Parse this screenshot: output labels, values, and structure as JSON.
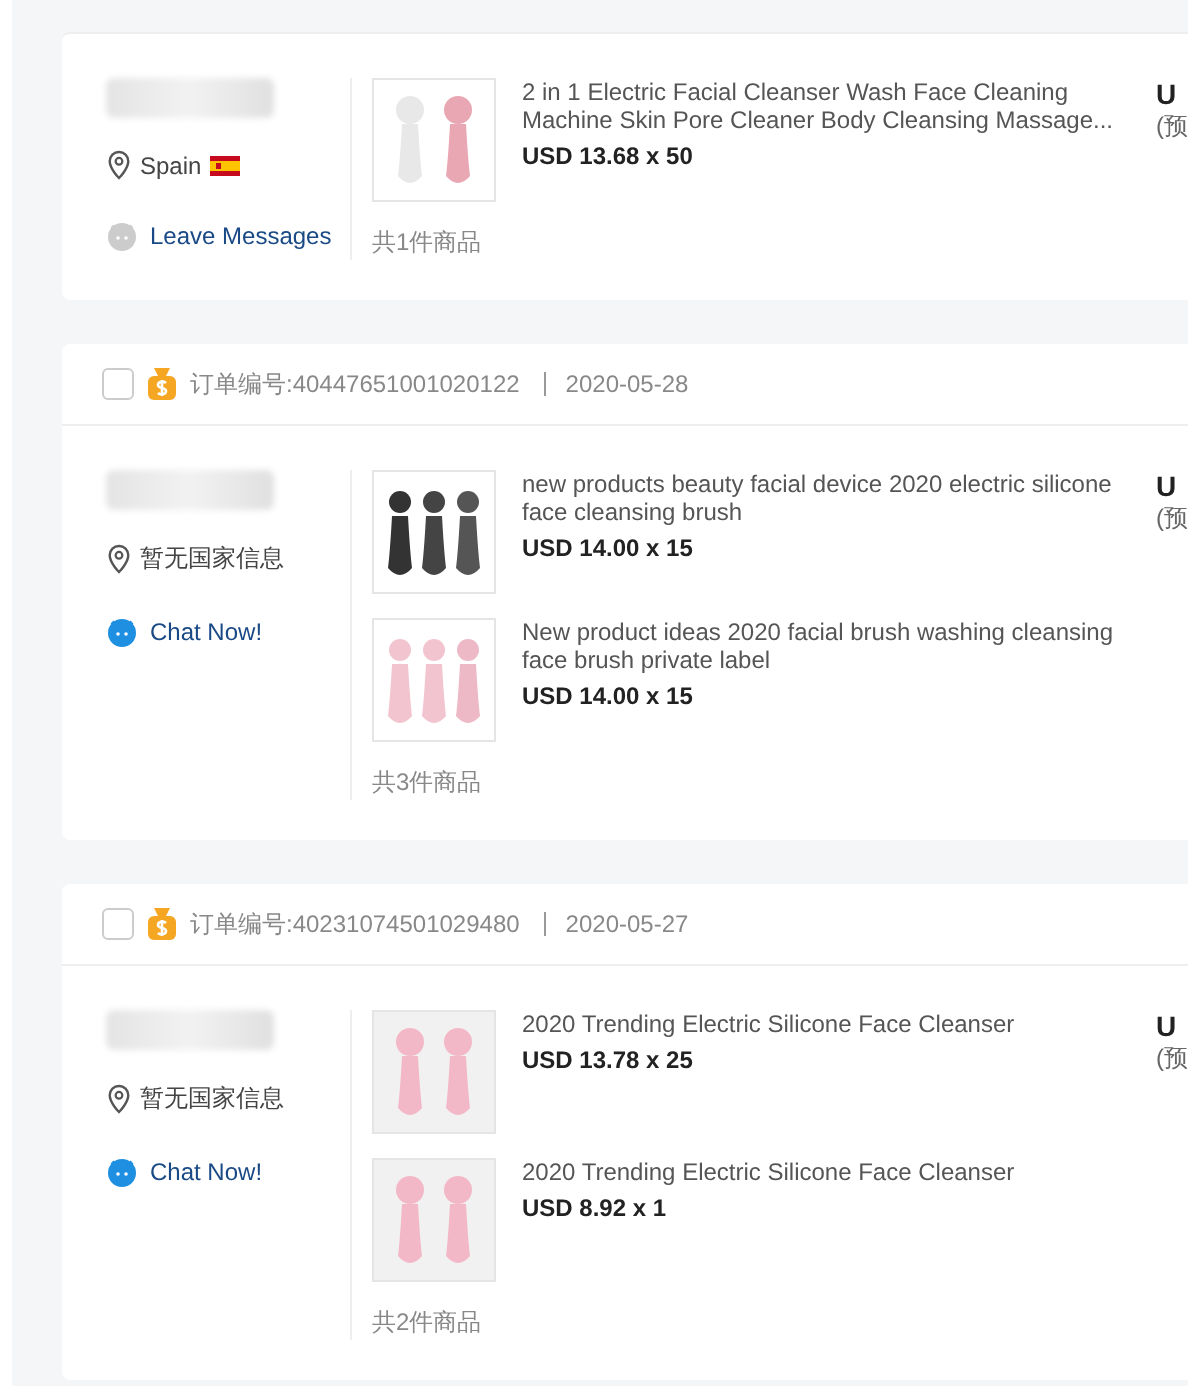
{
  "orders": [
    {
      "buyer": {
        "country": "Spain",
        "flag": true,
        "contact": {
          "kind": "offline",
          "label": "Leave Messages"
        }
      },
      "items": [
        {
          "title": "2 in 1 Electric Facial Cleanser Wash Face Cleaning Machine Skin Pore Cleaner Body Cleansing Massage...",
          "price": "USD 13.68 x 50"
        }
      ],
      "count_note": "共1件商品",
      "total_cut": "U",
      "note_cut": "(预"
    },
    {
      "header": {
        "checked": false,
        "order_no": "订单编号:40447651001020122",
        "date": "2020-05-28"
      },
      "buyer": {
        "country": "暂无国家信息",
        "flag": false,
        "contact": {
          "kind": "online",
          "label": "Chat Now!"
        }
      },
      "items": [
        {
          "title": "new products beauty facial device 2020 electric silicone face cleansing brush",
          "price": "USD 14.00 x 15"
        },
        {
          "title": "New product ideas 2020 facial brush washing cleansing face brush private label",
          "price": "USD 14.00 x 15"
        }
      ],
      "count_note": "共3件商品",
      "total_cut": "U",
      "note_cut": "(预"
    },
    {
      "header": {
        "checked": false,
        "order_no": "订单编号:40231074501029480",
        "date": "2020-05-27"
      },
      "buyer": {
        "country": "暂无国家信息",
        "flag": false,
        "contact": {
          "kind": "online",
          "label": "Chat Now!"
        }
      },
      "items": [
        {
          "title": "2020 Trending Electric Silicone Face Cleanser",
          "price": "USD 13.78 x 25"
        },
        {
          "title": "2020 Trending Electric Silicone Face Cleanser",
          "price": "USD 8.92 x 1"
        }
      ],
      "count_note": "共2件商品",
      "total_cut": "U",
      "note_cut": "(预"
    }
  ]
}
